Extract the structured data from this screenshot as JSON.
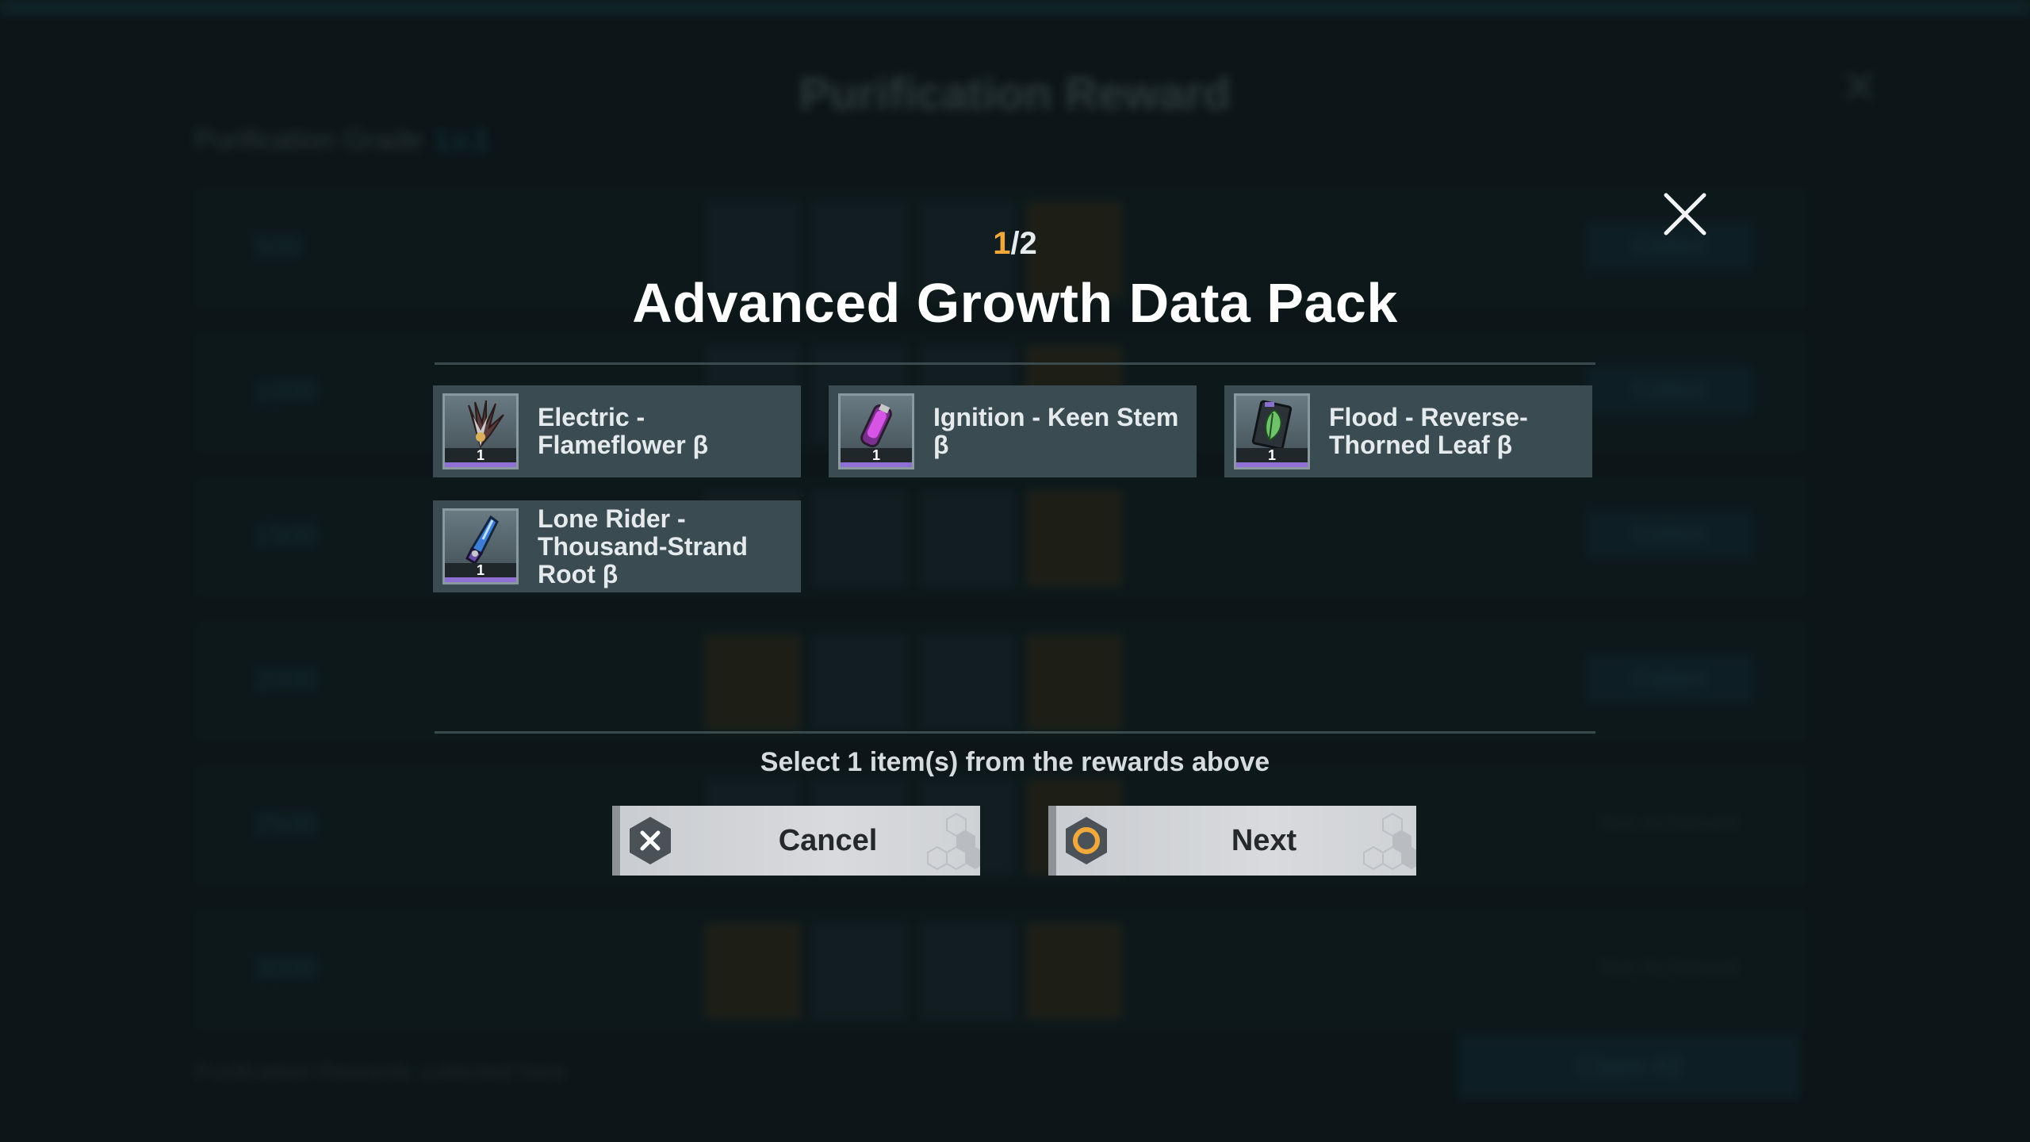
{
  "background": {
    "title": "Purification Reward",
    "subtitle_label": "Purification Grade",
    "subtitle_level": "Lv.1",
    "rows": [
      {
        "label": "500",
        "status": "Collect"
      },
      {
        "label": "1000",
        "status": "Collect"
      },
      {
        "label": "1500",
        "status": "Collect"
      },
      {
        "label": "2000",
        "status": "Collect"
      },
      {
        "label": "2500",
        "status": "Not Achieved"
      },
      {
        "label": "3000",
        "status": "Not Achieved"
      }
    ],
    "footer": "Purification Rewards collected here",
    "claim_all": "Claim All"
  },
  "dialog": {
    "counter_current": "1",
    "counter_total": "/2",
    "title": "Advanced Growth Data Pack",
    "hint": "Select 1 item(s) from the rewards above",
    "rewards": [
      {
        "name": "Electric - Flameflower β",
        "count": "1",
        "icon": "flameflower-icon"
      },
      {
        "name": "Ignition - Keen Stem β",
        "count": "1",
        "icon": "keen-stem-icon"
      },
      {
        "name": "Flood - Reverse-Thorned Leaf β",
        "count": "1",
        "icon": "thorned-leaf-icon"
      },
      {
        "name": "Lone Rider - Thousand-Strand Root β",
        "count": "1",
        "icon": "strand-root-icon"
      }
    ],
    "cancel_label": "Cancel",
    "next_label": "Next"
  },
  "colors": {
    "accent_counter": "#f2a93b",
    "rarity": "#8e6fd4",
    "button_bg": "#d8dadd"
  }
}
